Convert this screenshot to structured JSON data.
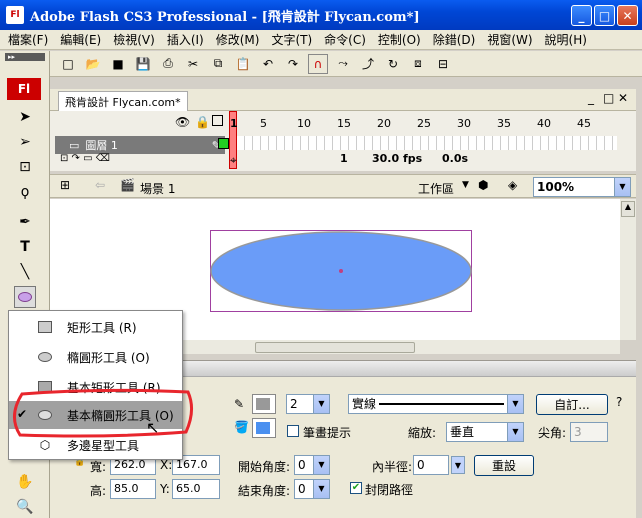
{
  "window": {
    "logo": "Fl",
    "title": "Adobe Flash CS3 Professional - [飛肯設計  Flycan.com*]",
    "min": "_",
    "max": "□",
    "close": "✕"
  },
  "menu": [
    "檔案(F)",
    "編輯(E)",
    "檢視(V)",
    "插入(I)",
    "修改(M)",
    "文字(T)",
    "命令(C)",
    "控制(O)",
    "除錯(D)",
    "視窗(W)",
    "說明(H)"
  ],
  "tools_logo": "Fl",
  "document": {
    "tab": "飛肯設計  Flycan.com*",
    "min": "_",
    "max": "□",
    "close": "✕"
  },
  "timeline": {
    "frames": [
      "1",
      "5",
      "10",
      "15",
      "20",
      "25",
      "30",
      "35",
      "40",
      "45"
    ],
    "layer_name": "圖層 1",
    "current_frame": "1",
    "fps": "30.0 fps",
    "time": "0.0s"
  },
  "editbar": {
    "scene": "場景 1",
    "workspace": "工作區",
    "zoom": "100%"
  },
  "stage": {
    "shape_fill": "#6a9cf8",
    "shape_stroke": "#999999"
  },
  "popup": {
    "items": [
      {
        "label": "矩形工具 (R)",
        "icon": "rectangle-icon",
        "checked": false
      },
      {
        "label": "橢圓形工具 (O)",
        "icon": "oval-icon",
        "checked": false
      },
      {
        "label": "基本矩形工具 (R)",
        "icon": "primitive-rectangle-icon",
        "checked": false
      },
      {
        "label": "基本橢圓形工具 (O)",
        "icon": "primitive-oval-icon",
        "checked": true
      },
      {
        "label": "多邊星型工具",
        "icon": "polystar-icon",
        "checked": false
      }
    ]
  },
  "props": {
    "stroke_width": "2",
    "stroke_style": "實線",
    "custom_button": "自訂...",
    "hinting_label": "筆畫提示",
    "scale_label": "縮放:",
    "scale_value": "垂直",
    "miter_label": "尖角:",
    "miter_value": "3",
    "w_label": "寬:",
    "w_value": "262.0",
    "x_label": "X:",
    "x_value": "167.0",
    "h_label": "高:",
    "h_value": "85.0",
    "y_label": "Y:",
    "y_value": "65.0",
    "start_angle_label": "開始角度:",
    "start_angle": "0",
    "end_angle_label": "結束角度:",
    "end_angle": "0",
    "inner_radius_label": "內半徑:",
    "inner_radius": "0",
    "reset_button": "重設",
    "close_path_label": "封閉路徑",
    "close_path_checked": true
  }
}
